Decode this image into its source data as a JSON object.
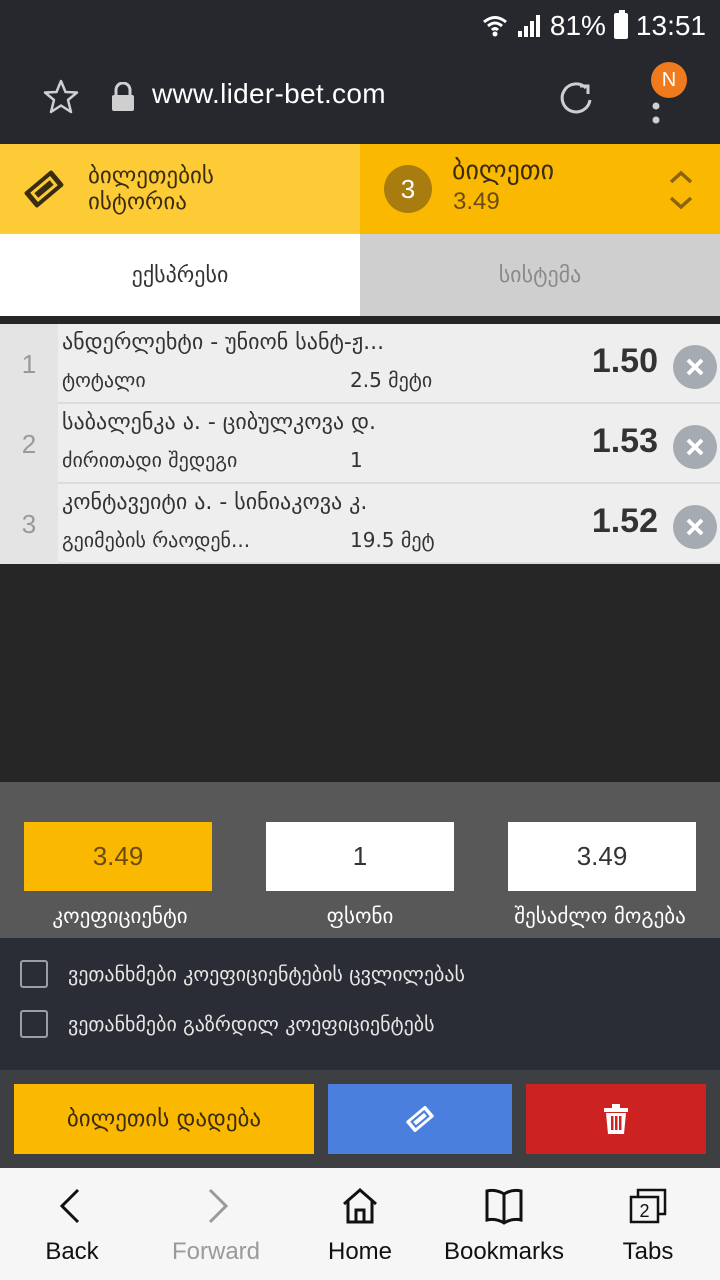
{
  "status_bar": {
    "battery": "81%",
    "time": "13:51"
  },
  "browser": {
    "url": "www.lider-bet.com",
    "notification_badge": "N"
  },
  "ticket_header": {
    "history_label_line1": "ბილეთების",
    "history_label_line2": "ისტორია",
    "count": "3",
    "title": "ბილეთი",
    "coefficient": "3.49"
  },
  "tabs": [
    {
      "label": "ექსპრესი",
      "active": true
    },
    {
      "label": "სისტემა",
      "active": false
    }
  ],
  "bets": [
    {
      "index": "1",
      "event": "ანდერლეხტი - უნიონ სანტ-ჟ...",
      "market": "ტოტალი",
      "outcome": "2.5 მეტი",
      "odd": "1.50"
    },
    {
      "index": "2",
      "event": "საბალენკა ა. - ციბულკოვა დ.",
      "market": "ძირითადი შედეგი",
      "outcome": "1",
      "odd": "1.53"
    },
    {
      "index": "3",
      "event": "კონტავეიტი ა. - სინიაკოვა კ.",
      "market": "გეიმების რაოდენ...",
      "outcome": "19.5 მეტ",
      "odd": "1.52"
    }
  ],
  "summary": {
    "coefficient_value": "3.49",
    "coefficient_label": "კოეფიციენტი",
    "stake_value": "1",
    "stake_label": "ფსონი",
    "win_value": "3.49",
    "win_label": "შესაძლო მოგება"
  },
  "agreements": {
    "accept_changes": "ვეთანხმები კოეფიციენტების ცვლილებას",
    "accept_boosted": "ვეთანხმები გაზრდილ კოეფიციენტებს"
  },
  "actions": {
    "place_bet": "ბილეთის დადება"
  },
  "bottom_nav": {
    "back": "Back",
    "forward": "Forward",
    "home": "Home",
    "bookmarks": "Bookmarks",
    "tabs": "Tabs",
    "tabs_count": "2"
  },
  "colors": {
    "accent_yellow": "#fbb800",
    "light_yellow": "#fccb36",
    "save_blue": "#4b7fde",
    "delete_red": "#cc2222"
  }
}
